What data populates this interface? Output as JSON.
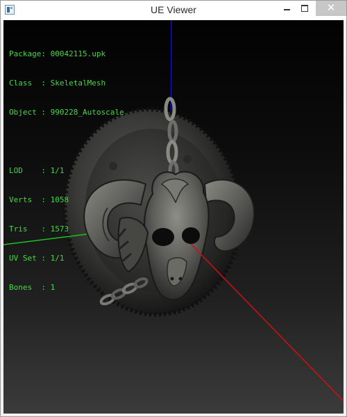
{
  "window": {
    "title": "UE Viewer",
    "close_glyph": "✕"
  },
  "info": {
    "package_label": "Package",
    "package_value": "00042115.upk",
    "class_label": "Class",
    "class_value": "SkeletalMesh",
    "object_label": "Object",
    "object_value": "990228_Autoscale",
    "lod_label": "LOD",
    "lod_value": "1/1",
    "verts_label": "Verts",
    "verts_value": "1058",
    "tris_label": "Tris",
    "tris_value": "1573",
    "uvset_label": "UV Set",
    "uvset_value": "1/1",
    "bones_label": "Bones",
    "bones_value": "1"
  },
  "colors": {
    "info_text": "#45d845",
    "axis_x": "#d01010",
    "axis_y": "#20c020",
    "axis_z": "#1010c0"
  },
  "icons": {
    "app": "ue-viewer-app-icon",
    "minimize": "minimize-icon",
    "maximize": "maximize-icon",
    "close": "close-icon"
  }
}
